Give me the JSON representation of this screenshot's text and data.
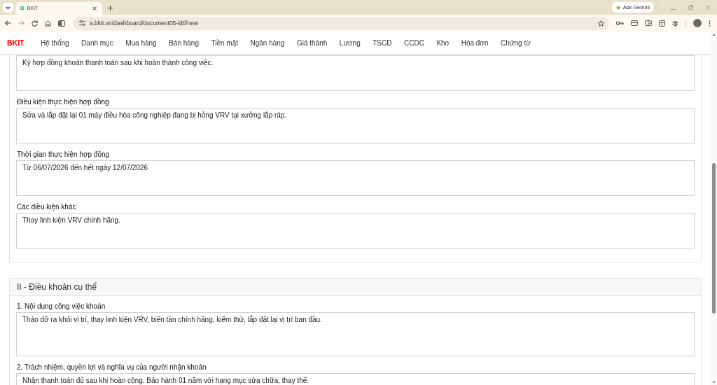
{
  "browser": {
    "tabs": [
      {
        "favicon": "B",
        "title": "BKIT",
        "selected": true
      }
    ],
    "ask_button": "Ask Gemini",
    "address": "a.bkit.vn/dashboard/document05-ldtl/new"
  },
  "navbar": {
    "brand": "BKIT",
    "items": [
      "Hệ thống",
      "Danh mục",
      "Mua hàng",
      "Bán hàng",
      "Tiền mặt",
      "Ngân hàng",
      "Giá thành",
      "Lương",
      "TSCĐ",
      "CCDC",
      "Kho",
      "Hóa đơn",
      "Chứng từ"
    ]
  },
  "sections": [
    {
      "fields": [
        {
          "value": "Ký hợp đồng khoán thanh toán sau khi hoàn thành công việc."
        },
        {
          "label": "Điều kiện thực hiện hợp đồng",
          "value": "Sửa và lắp đặt lại 01 máy điều hòa công nghiệp đang bị hỏng VRV tại xưởng lắp ráp."
        },
        {
          "label": "Thời gian thực hiện hợp đồng",
          "value": "Từ 06/07/2026 đến hết ngày 12/07/2026"
        },
        {
          "label": "Các điều kiện khác",
          "value": "Thay linh kiện VRV chính hãng."
        }
      ]
    },
    {
      "title": "II - Điều khoản cụ thể",
      "fields": [
        {
          "label": "1. Nội dung công việc khoán",
          "value": "Tháo dỡ ra khỏi vị trí, thay linh kiện VRV, biến tần chính hãng, kiểm thử, lắp đặt lại vị trí ban đầu."
        },
        {
          "label": "2. Trách nhiệm, quyền lợi và nghĩa vụ của người nhận khoán",
          "value": "Nhận thanh toán đủ sau khi hoàn công. Bảo hành 01 năm với hạng mục sửa chữa, thay thế."
        }
      ]
    }
  ]
}
